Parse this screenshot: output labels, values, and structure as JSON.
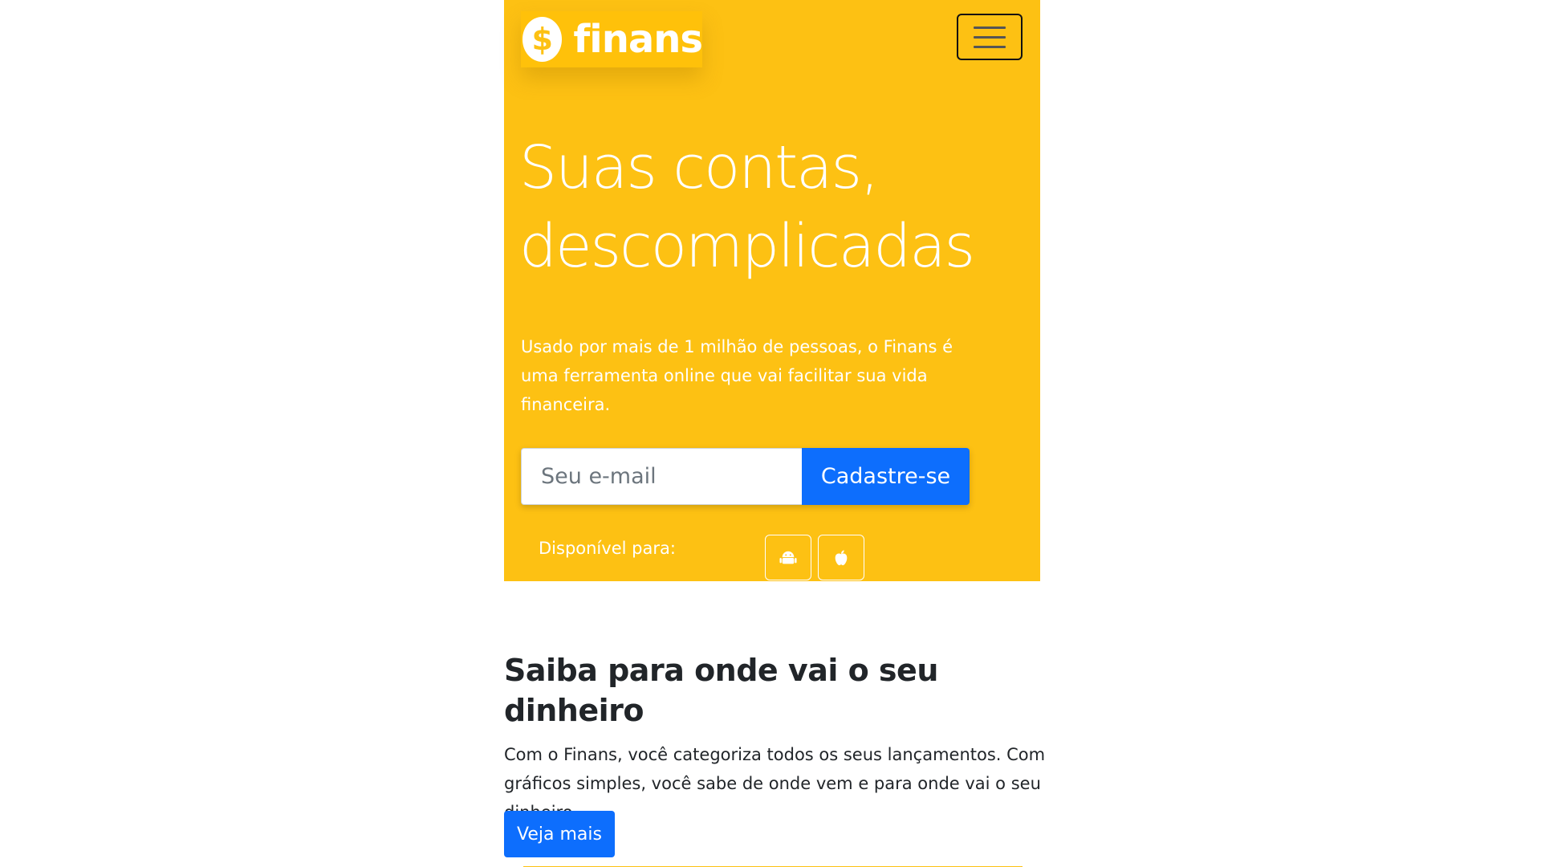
{
  "brand": {
    "logo_symbol": "$",
    "name": "finans"
  },
  "navbar": {
    "menu_icon": "hamburger-menu-icon"
  },
  "hero": {
    "title_line1": "Suas contas,",
    "title_line2": "descomplicadas",
    "description": "Usado por mais de 1 milhão de pessoas, o Finans é uma ferramenta online que vai facilitar sua vida financeira.",
    "email_placeholder": "Seu e-mail",
    "signup_label": "Cadastre-se",
    "available_label": "Disponível para:",
    "platforms": [
      {
        "icon": "android-icon"
      },
      {
        "icon": "apple-icon"
      }
    ]
  },
  "section": {
    "title": "Saiba para onde vai o seu dinheiro",
    "text": "Com o Finans, você categoriza todos os seus lançamentos. Com gráficos simples, você sabe de onde vem e para onde vai o seu dinheiro.",
    "button_label": "Veja mais"
  },
  "colors": {
    "hero_background": "#FDC113",
    "primary_button": "#0D6EFD",
    "heading_text": "#212529"
  }
}
